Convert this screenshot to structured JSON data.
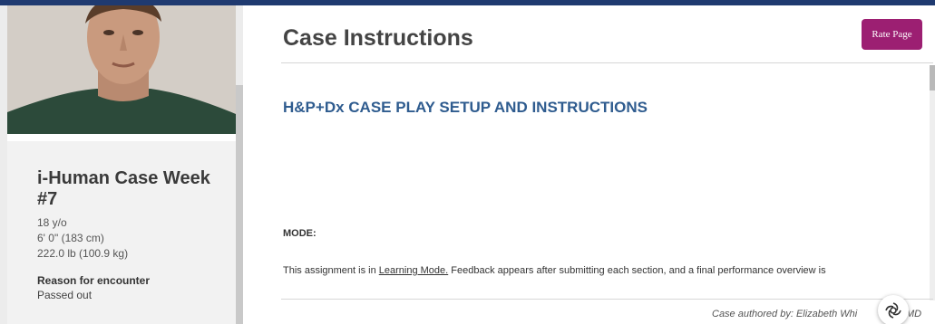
{
  "patient": {
    "case_title": "i-Human Case Week #7",
    "age": "18 y/o",
    "height": "6' 0\" (183 cm)",
    "weight": "222.0 lb (100.9 kg)",
    "reason_label": "Reason for encounter",
    "reason_value": "Passed out"
  },
  "main": {
    "page_title": "Case Instructions",
    "rate_button": "Rate Page",
    "section_title": "H&P+Dx CASE PLAY SETUP AND INSTRUCTIONS",
    "mode_label": "MODE:",
    "body_before_link": "This assignment is in ",
    "body_link": "Learning Mode.",
    "body_after_link": " Feedback appears after submitting each section, and a final performance overview is",
    "author_text": "Case authored by: Elizabeth Whi",
    "author_suffix": "MD"
  },
  "colors": {
    "accent_button": "#9c1f72",
    "section_title": "#2f5c8f",
    "top_bar": "#1f3a70"
  },
  "icons": {
    "help": "help-swirl-icon"
  }
}
